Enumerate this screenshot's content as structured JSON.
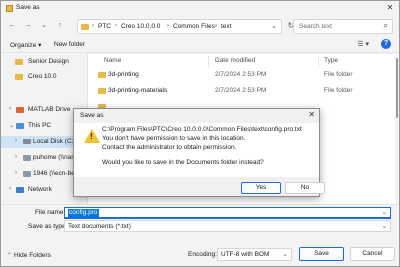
{
  "window": {
    "title": "Save as"
  },
  "nav": {
    "back": "←",
    "forward": "→",
    "recent": "⌄",
    "up": "↑",
    "breadcrumbs": [
      "PTC",
      "Creo 10.0.0.0",
      "Common Files",
      "text"
    ],
    "search_placeholder": "Search text"
  },
  "commands": {
    "organize": "Organize ▾",
    "new_folder": "New folder",
    "view": "☰ ▾",
    "help": "?"
  },
  "sidebar": {
    "items": [
      {
        "label": "Senior Design",
        "icon": "folder-icon"
      },
      {
        "label": "Creo 10.0",
        "icon": "folder-icon"
      },
      {
        "label": "MATLAB Drive",
        "icon": "matlab-icon",
        "expander": "›"
      },
      {
        "label": "This PC",
        "icon": "pc-icon",
        "expander": "⌄"
      },
      {
        "label": "Local Disk (C:)",
        "icon": "drive-icon",
        "expander": "›",
        "selected": true
      },
      {
        "label": "puhome (\\\\nas01",
        "icon": "network-drive-icon",
        "expander": "›"
      },
      {
        "label": "1946 (\\\\ecn-beldi",
        "icon": "network-drive-icon",
        "expander": "›"
      },
      {
        "label": "Network",
        "icon": "network-icon",
        "expander": "›"
      }
    ]
  },
  "filelist": {
    "columns": {
      "name": "Name",
      "date": "Date modified",
      "type": "Type"
    },
    "rows": [
      {
        "name": "3d-printing",
        "date": "2/7/2024 2:53 PM",
        "type": "File folder"
      },
      {
        "name": "3d-printing-materials",
        "date": "2/7/2024 2:53 PM",
        "type": "File folder"
      },
      {
        "name": "",
        "date": "",
        "type": ""
      },
      {
        "name": "",
        "date": "",
        "type": ""
      },
      {
        "name": "",
        "date": "",
        "type": ""
      },
      {
        "name": "",
        "date": "",
        "type": ""
      },
      {
        "name": "",
        "date": "",
        "type": ""
      },
      {
        "name": "",
        "date": "",
        "type": ""
      }
    ]
  },
  "form": {
    "file_name_label": "File name:",
    "file_name_value": "config.pro",
    "save_type_label": "Save as type:",
    "save_type_value": "Text documents (*.txt)",
    "hide_folders": "Hide Folders",
    "encoding_label": "Encoding:",
    "encoding_value": "UTF-8 with BOM",
    "save_button": "Save",
    "cancel_button": "Cancel"
  },
  "dialog": {
    "title": "Save as",
    "lines": [
      "C:\\Program Files\\PTC\\Creo 10.0.0.0\\Common Files\\text\\config.pro.txt",
      "You don't have permission to save in this location.",
      "Contact the administrator to obtain permission.",
      "Would you like to save in the Documents folder instead?"
    ],
    "yes": "Yes",
    "no": "No"
  },
  "colors": {
    "accent": "#1e6ad8",
    "folder": "#e9b94a",
    "warning": "#f2c12e",
    "selection": "#cfe3f7"
  }
}
